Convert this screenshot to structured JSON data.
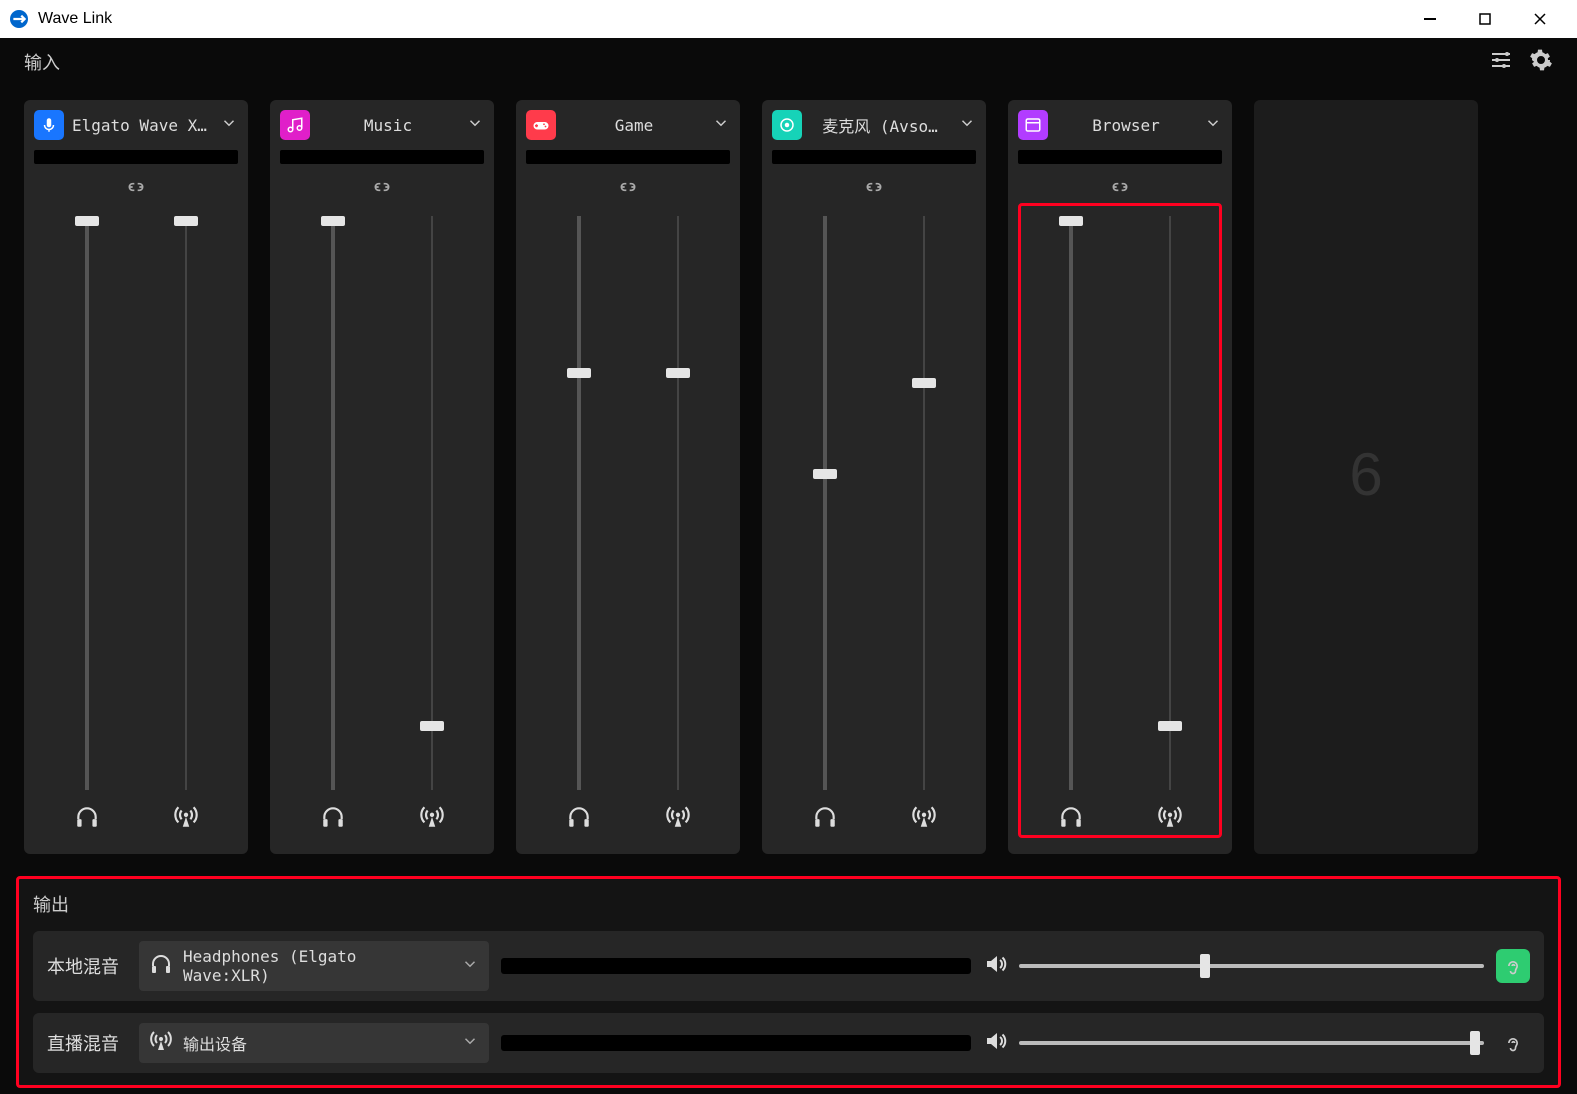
{
  "app": {
    "title": "Wave Link"
  },
  "header": {
    "input_label": "输入"
  },
  "channels": [
    {
      "name": "Elgato Wave XLR",
      "icon": "mic",
      "color": "#1976ff",
      "slider1": 100,
      "slider2": 100
    },
    {
      "name": "Music",
      "icon": "music",
      "color": "#e01fc9",
      "slider1": 100,
      "slider2": 0
    },
    {
      "name": "Game",
      "icon": "gamepad",
      "color": "#ff3b4b",
      "slider1": 70,
      "slider2": 70
    },
    {
      "name": "麦克风 (Avso…",
      "icon": "record",
      "color": "#16d3b8",
      "slider1": 50,
      "slider2": 68
    },
    {
      "name": "Browser",
      "icon": "browser",
      "color": "#b23cff",
      "slider1": 100,
      "slider2": 0,
      "highlighted": true
    }
  ],
  "placeholder": {
    "number": "6"
  },
  "output": {
    "title": "输出",
    "rows": [
      {
        "label": "本地混音",
        "device": "Headphones (Elgato Wave:XLR)",
        "icon": "headphones",
        "volume": 40,
        "monitor": true
      },
      {
        "label": "直播混音",
        "device": "输出设备",
        "icon": "broadcast",
        "volume": 98,
        "monitor": false
      }
    ]
  }
}
